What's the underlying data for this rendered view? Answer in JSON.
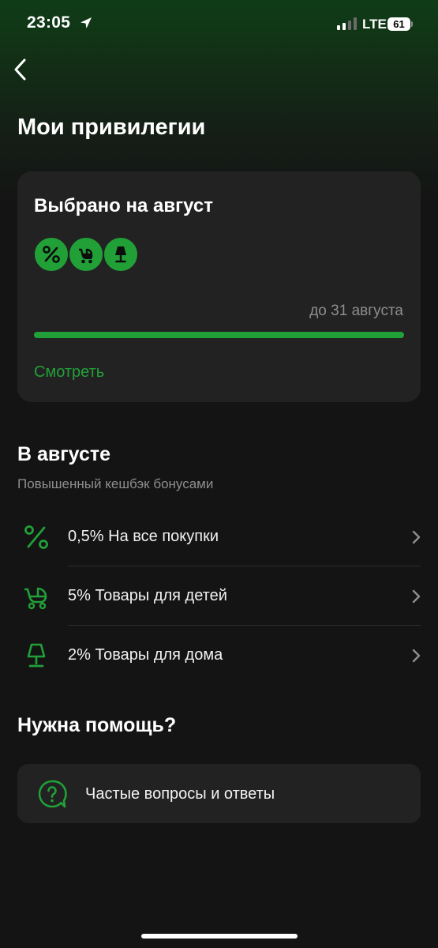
{
  "status_bar": {
    "time": "23:05",
    "network": "LTE",
    "battery": "61",
    "icons": [
      "location-arrow-icon",
      "signal-icon"
    ]
  },
  "header": {
    "back_icon": "chevron-left-icon",
    "title": "Мои привилегии"
  },
  "selected_card": {
    "title": "Выбрано на август",
    "badges": [
      "percent-icon",
      "stroller-icon",
      "lamp-icon"
    ],
    "deadline": "до 31 августа",
    "progress": 1.0,
    "view_label": "Смотреть"
  },
  "august": {
    "title": "В августе",
    "subtitle": "Повышенный кешбэк бонусами",
    "items": [
      {
        "icon": "percent-icon",
        "label": "0,5% На все покупки"
      },
      {
        "icon": "stroller-icon",
        "label": "5% Товары для детей"
      },
      {
        "icon": "lamp-icon",
        "label": "2% Товары для дома"
      }
    ]
  },
  "help": {
    "title": "Нужна помощь?",
    "faq_icon": "question-bubble-icon",
    "faq_label": "Частые вопросы и ответы"
  },
  "colors": {
    "accent": "#21a038",
    "background": "#141414",
    "card": "#222222",
    "muted_text": "#8e8e8e"
  }
}
